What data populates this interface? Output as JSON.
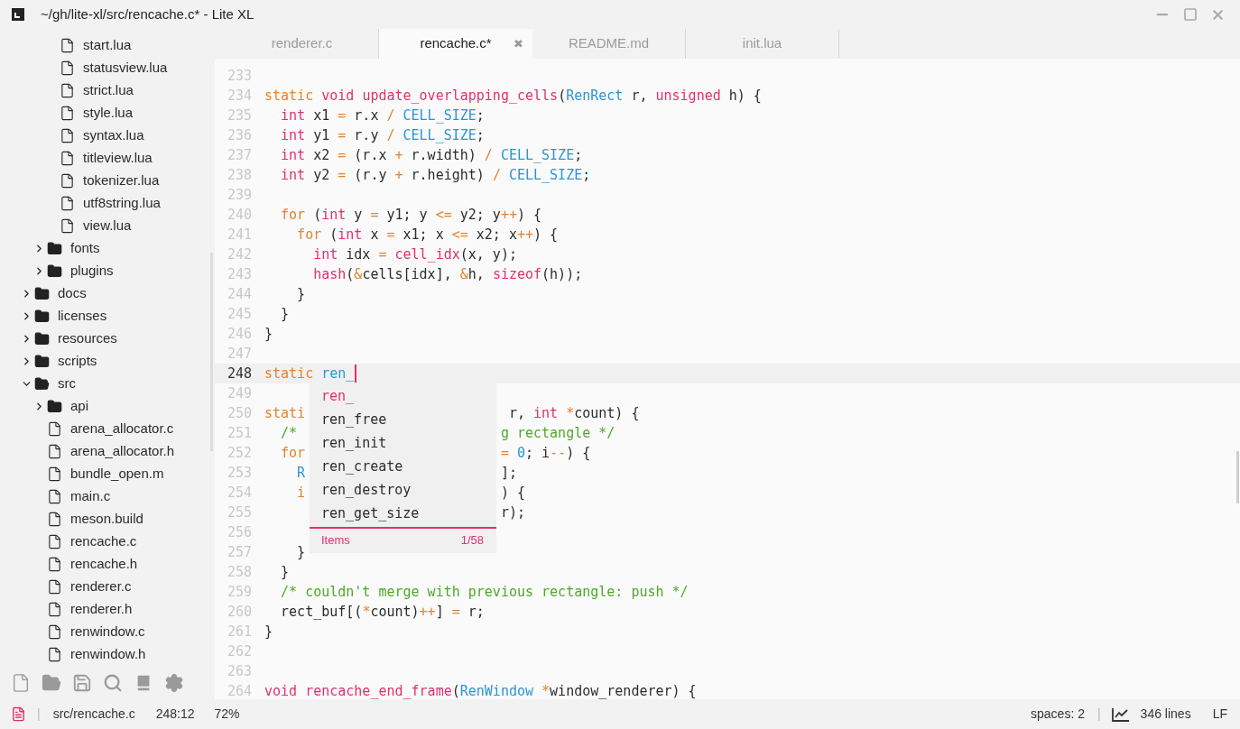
{
  "window": {
    "title": "~/gh/lite-xl/src/rencache.c* - Lite XL"
  },
  "tree": [
    {
      "children": [
        {
          "children": [
            {
              "kind": "file",
              "name": "start.lua"
            },
            {
              "kind": "file",
              "name": "statusview.lua"
            },
            {
              "kind": "file",
              "name": "strict.lua"
            },
            {
              "kind": "file",
              "name": "style.lua"
            },
            {
              "kind": "file",
              "name": "syntax.lua"
            },
            {
              "kind": "file",
              "name": "titleview.lua"
            },
            {
              "kind": "file",
              "name": "tokenizer.lua"
            },
            {
              "kind": "file",
              "name": "utf8string.lua"
            },
            {
              "kind": "file",
              "name": "view.lua"
            }
          ]
        },
        {
          "kind": "folder",
          "name": "fonts",
          "expanded": false
        },
        {
          "kind": "folder",
          "name": "plugins",
          "expanded": false
        }
      ]
    },
    {
      "kind": "folder",
      "name": "docs",
      "expanded": false
    },
    {
      "kind": "folder",
      "name": "licenses",
      "expanded": false
    },
    {
      "kind": "folder",
      "name": "resources",
      "expanded": false
    },
    {
      "kind": "folder",
      "name": "scripts",
      "expanded": false
    },
    {
      "kind": "folder",
      "name": "src",
      "expanded": true,
      "children": [
        {
          "kind": "folder",
          "name": "api",
          "expanded": false
        },
        {
          "kind": "file",
          "name": "arena_allocator.c"
        },
        {
          "kind": "file",
          "name": "arena_allocator.h"
        },
        {
          "kind": "file",
          "name": "bundle_open.m"
        },
        {
          "kind": "file",
          "name": "main.c"
        },
        {
          "kind": "file",
          "name": "meson.build"
        },
        {
          "kind": "file",
          "name": "rencache.c"
        },
        {
          "kind": "file",
          "name": "rencache.h"
        },
        {
          "kind": "file",
          "name": "renderer.c"
        },
        {
          "kind": "file",
          "name": "renderer.h"
        },
        {
          "kind": "file",
          "name": "renwindow.c"
        },
        {
          "kind": "file",
          "name": "renwindow.h"
        }
      ]
    }
  ],
  "tabs": [
    {
      "label": "renderer.c",
      "selected": false
    },
    {
      "label": "rencache.c*",
      "selected": true,
      "close": "✖"
    },
    {
      "label": "README.md",
      "selected": false
    },
    {
      "label": "init.lua",
      "selected": false
    }
  ],
  "lines": [
    {
      "number": "233",
      "current": false
    },
    {
      "number": "234",
      "current": false,
      "tokens": [
        {
          "kind": "kw",
          "text": "static "
        },
        {
          "kind": "ty",
          "text": "void "
        },
        {
          "kind": "fn",
          "text": "update_overlapping_cells"
        },
        {
          "kind": "tx",
          "text": "("
        },
        {
          "kind": "lit",
          "text": "RenRect"
        },
        {
          "kind": "tx",
          "text": " r, "
        },
        {
          "kind": "ty",
          "text": "unsigned"
        },
        {
          "kind": "tx",
          "text": " h) {"
        }
      ]
    },
    {
      "number": "235",
      "current": false,
      "tokens": [
        {
          "kind": "ty",
          "text": "  int"
        },
        {
          "kind": "tx",
          "text": " x1 "
        },
        {
          "kind": "op",
          "text": "="
        },
        {
          "kind": "tx",
          "text": " r.x "
        },
        {
          "kind": "op",
          "text": "/ "
        },
        {
          "kind": "lit",
          "text": "CELL_SIZE"
        },
        {
          "kind": "tx",
          "text": ";"
        }
      ]
    },
    {
      "number": "236",
      "current": false,
      "tokens": [
        {
          "kind": "ty",
          "text": "  int"
        },
        {
          "kind": "tx",
          "text": " y1 "
        },
        {
          "kind": "op",
          "text": "="
        },
        {
          "kind": "tx",
          "text": " r.y "
        },
        {
          "kind": "op",
          "text": "/ "
        },
        {
          "kind": "lit",
          "text": "CELL_SIZE"
        },
        {
          "kind": "tx",
          "text": ";"
        }
      ]
    },
    {
      "number": "237",
      "current": false,
      "tokens": [
        {
          "kind": "ty",
          "text": "  int"
        },
        {
          "kind": "tx",
          "text": " x2 "
        },
        {
          "kind": "op",
          "text": "="
        },
        {
          "kind": "tx",
          "text": " (r.x "
        },
        {
          "kind": "op",
          "text": "+"
        },
        {
          "kind": "tx",
          "text": " r.width) "
        },
        {
          "kind": "op",
          "text": "/ "
        },
        {
          "kind": "lit",
          "text": "CELL_SIZE"
        },
        {
          "kind": "tx",
          "text": ";"
        }
      ]
    },
    {
      "number": "238",
      "current": false,
      "tokens": [
        {
          "kind": "ty",
          "text": "  int"
        },
        {
          "kind": "tx",
          "text": " y2 "
        },
        {
          "kind": "op",
          "text": "="
        },
        {
          "kind": "tx",
          "text": " (r.y "
        },
        {
          "kind": "op",
          "text": "+"
        },
        {
          "kind": "tx",
          "text": " r.height) "
        },
        {
          "kind": "op",
          "text": "/ "
        },
        {
          "kind": "lit",
          "text": "CELL_SIZE"
        },
        {
          "kind": "tx",
          "text": ";"
        }
      ]
    },
    {
      "number": "239",
      "current": false
    },
    {
      "number": "240",
      "current": false,
      "tokens": [
        {
          "kind": "kw",
          "text": "  for"
        },
        {
          "kind": "tx",
          "text": " ("
        },
        {
          "kind": "ty",
          "text": "int"
        },
        {
          "kind": "tx",
          "text": " y "
        },
        {
          "kind": "op",
          "text": "="
        },
        {
          "kind": "tx",
          "text": " y1; y "
        },
        {
          "kind": "op",
          "text": "<="
        },
        {
          "kind": "tx",
          "text": " y2; y"
        },
        {
          "kind": "op",
          "text": "++"
        },
        {
          "kind": "tx",
          "text": ") {"
        }
      ]
    },
    {
      "number": "241",
      "current": false,
      "tokens": [
        {
          "kind": "kw",
          "text": "    for"
        },
        {
          "kind": "tx",
          "text": " ("
        },
        {
          "kind": "ty",
          "text": "int"
        },
        {
          "kind": "tx",
          "text": " x "
        },
        {
          "kind": "op",
          "text": "="
        },
        {
          "kind": "tx",
          "text": " x1; x "
        },
        {
          "kind": "op",
          "text": "<="
        },
        {
          "kind": "tx",
          "text": " x2; x"
        },
        {
          "kind": "op",
          "text": "++"
        },
        {
          "kind": "tx",
          "text": ") {"
        }
      ]
    },
    {
      "number": "242",
      "current": false,
      "tokens": [
        {
          "kind": "ty",
          "text": "      int"
        },
        {
          "kind": "tx",
          "text": " idx "
        },
        {
          "kind": "op",
          "text": "= "
        },
        {
          "kind": "fn",
          "text": "cell_idx"
        },
        {
          "kind": "tx",
          "text": "(x, y);"
        }
      ]
    },
    {
      "number": "243",
      "current": false,
      "tokens": [
        {
          "kind": "fn",
          "text": "      hash"
        },
        {
          "kind": "tx",
          "text": "("
        },
        {
          "kind": "op",
          "text": "&"
        },
        {
          "kind": "tx",
          "text": "cells[idx], "
        },
        {
          "kind": "op",
          "text": "&"
        },
        {
          "kind": "tx",
          "text": "h, "
        },
        {
          "kind": "ty",
          "text": "sizeof"
        },
        {
          "kind": "tx",
          "text": "(h));"
        }
      ]
    },
    {
      "number": "244",
      "current": false,
      "tokens": [
        {
          "kind": "tx",
          "text": "    }"
        }
      ]
    },
    {
      "number": "245",
      "current": false,
      "tokens": [
        {
          "kind": "tx",
          "text": "  }"
        }
      ]
    },
    {
      "number": "246",
      "current": false,
      "tokens": [
        {
          "kind": "tx",
          "text": "}"
        }
      ]
    },
    {
      "number": "247",
      "current": false
    },
    {
      "number": "248",
      "current": true,
      "tokens": [
        {
          "kind": "kw",
          "text": "static "
        },
        {
          "kind": "lit",
          "text": "ren_"
        }
      ]
    },
    {
      "number": "249",
      "current": false
    },
    {
      "number": "250",
      "current": false,
      "tokens": [
        {
          "kind": "kw",
          "text": "stati"
        }
      ],
      "after_popup": [
        {
          "kind": "tx",
          "text": " r, "
        },
        {
          "kind": "ty",
          "text": "int "
        },
        {
          "kind": "op",
          "text": "*"
        },
        {
          "kind": "tx",
          "text": "count) {"
        }
      ]
    },
    {
      "number": "251",
      "current": false,
      "tokens": [
        {
          "kind": "cm",
          "text": "  /*"
        }
      ],
      "after_popup": [
        {
          "kind": "cm",
          "text": "g rectangle */"
        }
      ]
    },
    {
      "number": "252",
      "current": false,
      "tokens": [
        {
          "kind": "kw",
          "text": "  for"
        }
      ],
      "after_popup": [
        {
          "kind": "op",
          "text": "= "
        },
        {
          "kind": "lit",
          "text": "0"
        },
        {
          "kind": "tx",
          "text": "; i"
        },
        {
          "kind": "op",
          "text": "--"
        },
        {
          "kind": "tx",
          "text": ") {"
        }
      ]
    },
    {
      "number": "253",
      "current": false,
      "tokens": [
        {
          "kind": "lit",
          "text": "    R"
        }
      ],
      "after_popup": [
        {
          "kind": "tx",
          "text": "];"
        }
      ]
    },
    {
      "number": "254",
      "current": false,
      "tokens": [
        {
          "kind": "kw",
          "text": "    i"
        }
      ],
      "after_popup": [
        {
          "kind": "tx",
          "text": ") {"
        }
      ]
    },
    {
      "number": "255",
      "current": false,
      "after_popup": [
        {
          "kind": "tx",
          "text": "r);"
        }
      ]
    },
    {
      "number": "256",
      "current": false
    },
    {
      "number": "257",
      "current": false,
      "tokens": [
        {
          "kind": "tx",
          "text": "    }"
        }
      ]
    },
    {
      "number": "258",
      "current": false,
      "tokens": [
        {
          "kind": "tx",
          "text": "  }"
        }
      ]
    },
    {
      "number": "259",
      "current": false,
      "tokens": [
        {
          "kind": "cm",
          "text": "  /* couldn't merge with previous rectangle: push */"
        }
      ]
    },
    {
      "number": "260",
      "current": false,
      "tokens": [
        {
          "kind": "tx",
          "text": "  rect_buf[("
        },
        {
          "kind": "op",
          "text": "*"
        },
        {
          "kind": "tx",
          "text": "count)"
        },
        {
          "kind": "op",
          "text": "++"
        },
        {
          "kind": "tx",
          "text": "] "
        },
        {
          "kind": "op",
          "text": "="
        },
        {
          "kind": "tx",
          "text": " r;"
        }
      ]
    },
    {
      "number": "261",
      "current": false,
      "tokens": [
        {
          "kind": "tx",
          "text": "}"
        }
      ]
    },
    {
      "number": "262",
      "current": false
    },
    {
      "number": "263",
      "current": false
    },
    {
      "number": "264",
      "current": false,
      "tokens": [
        {
          "kind": "ty",
          "text": "void "
        },
        {
          "kind": "fn",
          "text": "rencache_end_frame"
        },
        {
          "kind": "tx",
          "text": "("
        },
        {
          "kind": "lit",
          "text": "RenWindow "
        },
        {
          "kind": "op",
          "text": "*"
        },
        {
          "kind": "tx",
          "text": "window_renderer) {"
        }
      ]
    }
  ],
  "autocomplete": {
    "items": [
      {
        "label": "ren_",
        "selected": true
      },
      {
        "label": "ren_free",
        "selected": false
      },
      {
        "label": "ren_init",
        "selected": false
      },
      {
        "label": "ren_create",
        "selected": false
      },
      {
        "label": "ren_destroy",
        "selected": false
      },
      {
        "label": "ren_get_size",
        "selected": false
      }
    ],
    "footer_label": "Items",
    "count": "1/58"
  },
  "status_bar": {
    "separator_left": "|",
    "file": "src/rencache.c",
    "position": "248:12",
    "zoom": "72%",
    "indent": "spaces: 2",
    "separator_right": "|",
    "lines": "346 lines",
    "line_ending": "LF"
  }
}
